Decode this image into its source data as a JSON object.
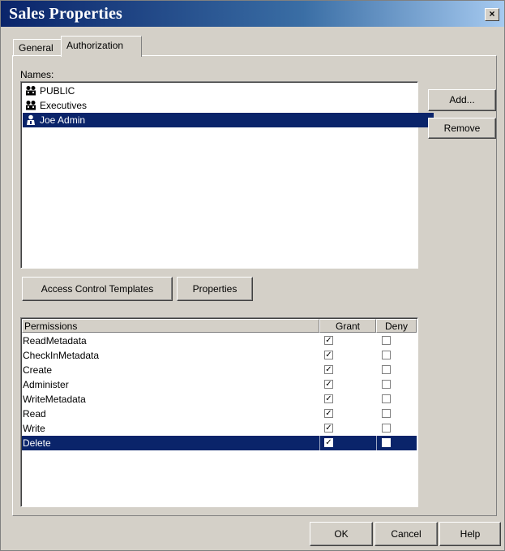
{
  "window": {
    "title": "Sales Properties",
    "close_label": "×"
  },
  "tabs": [
    {
      "label": "General",
      "active": false
    },
    {
      "label": "Authorization",
      "active": true
    }
  ],
  "names": {
    "label": "Names:",
    "items": [
      {
        "label": "PUBLIC",
        "icon": "group-icon",
        "selected": false
      },
      {
        "label": "Executives",
        "icon": "group-icon",
        "selected": false
      },
      {
        "label": "Joe Admin",
        "icon": "user-icon",
        "selected": true
      }
    ]
  },
  "buttons": {
    "add": "Add...",
    "remove": "Remove",
    "access_control_templates": "Access Control Templates",
    "properties": "Properties",
    "ok": "OK",
    "cancel": "Cancel",
    "help": "Help"
  },
  "permissions": {
    "columns": [
      "Permissions",
      "Grant",
      "Deny"
    ],
    "rows": [
      {
        "name": "ReadMetadata",
        "grant": true,
        "deny": false,
        "selected": false
      },
      {
        "name": "CheckInMetadata",
        "grant": true,
        "deny": false,
        "selected": false
      },
      {
        "name": "Create",
        "grant": true,
        "deny": false,
        "selected": false
      },
      {
        "name": "Administer",
        "grant": true,
        "deny": false,
        "selected": false
      },
      {
        "name": "WriteMetadata",
        "grant": true,
        "deny": false,
        "selected": false
      },
      {
        "name": "Read",
        "grant": true,
        "deny": false,
        "selected": false
      },
      {
        "name": "Write",
        "grant": true,
        "deny": false,
        "selected": false
      },
      {
        "name": "Delete",
        "grant": true,
        "deny": false,
        "selected": true
      }
    ]
  },
  "colors": {
    "selection": "#0a246a",
    "face": "#d4d0c8"
  }
}
